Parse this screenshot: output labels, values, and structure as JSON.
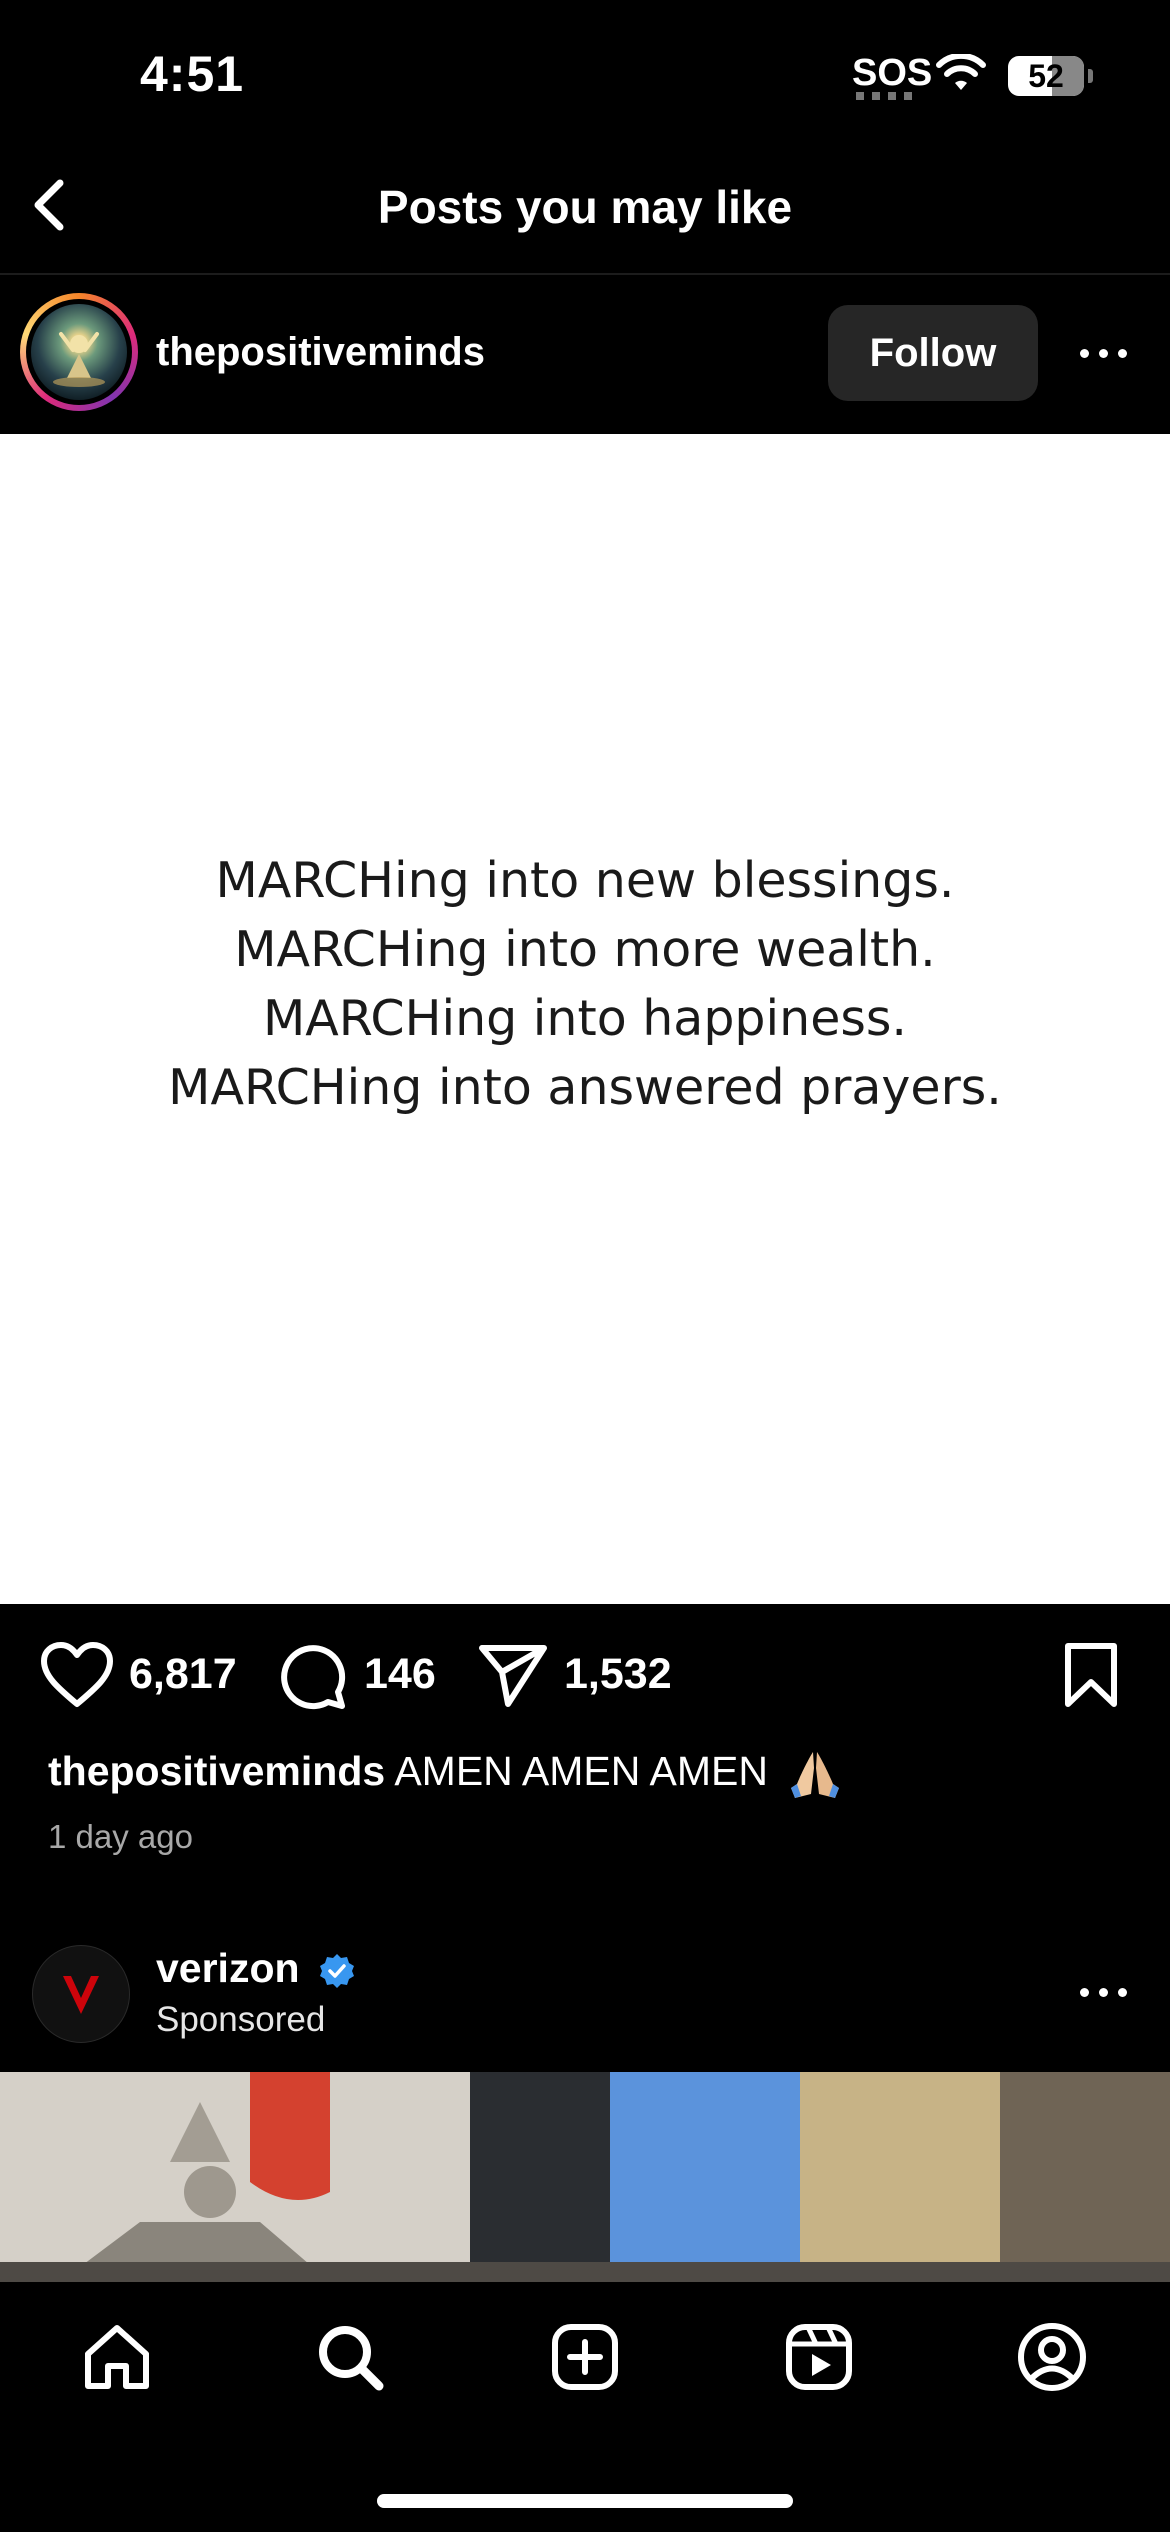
{
  "status_bar": {
    "time": "4:51",
    "carrier": "SOS",
    "battery": "52"
  },
  "nav": {
    "title": "Posts you may like"
  },
  "post": {
    "username": "thepositiveminds",
    "follow_label": "Follow",
    "image_lines": [
      "MARCHing into new blessings.",
      "MARCHing into more wealth.",
      "MARCHing into happiness.",
      "MARCHing into answered prayers."
    ],
    "likes": "6,817",
    "comments": "146",
    "shares": "1,532",
    "caption_user": "thepositiveminds",
    "caption_text": "AMEN AMEN AMEN",
    "time_ago": "1 day ago"
  },
  "ad": {
    "username": "verizon",
    "label": "Sponsored",
    "brand_color": "#cd040b"
  },
  "tabs": [
    "home-icon",
    "search-icon",
    "create-icon",
    "reels-icon",
    "profile-icon"
  ]
}
